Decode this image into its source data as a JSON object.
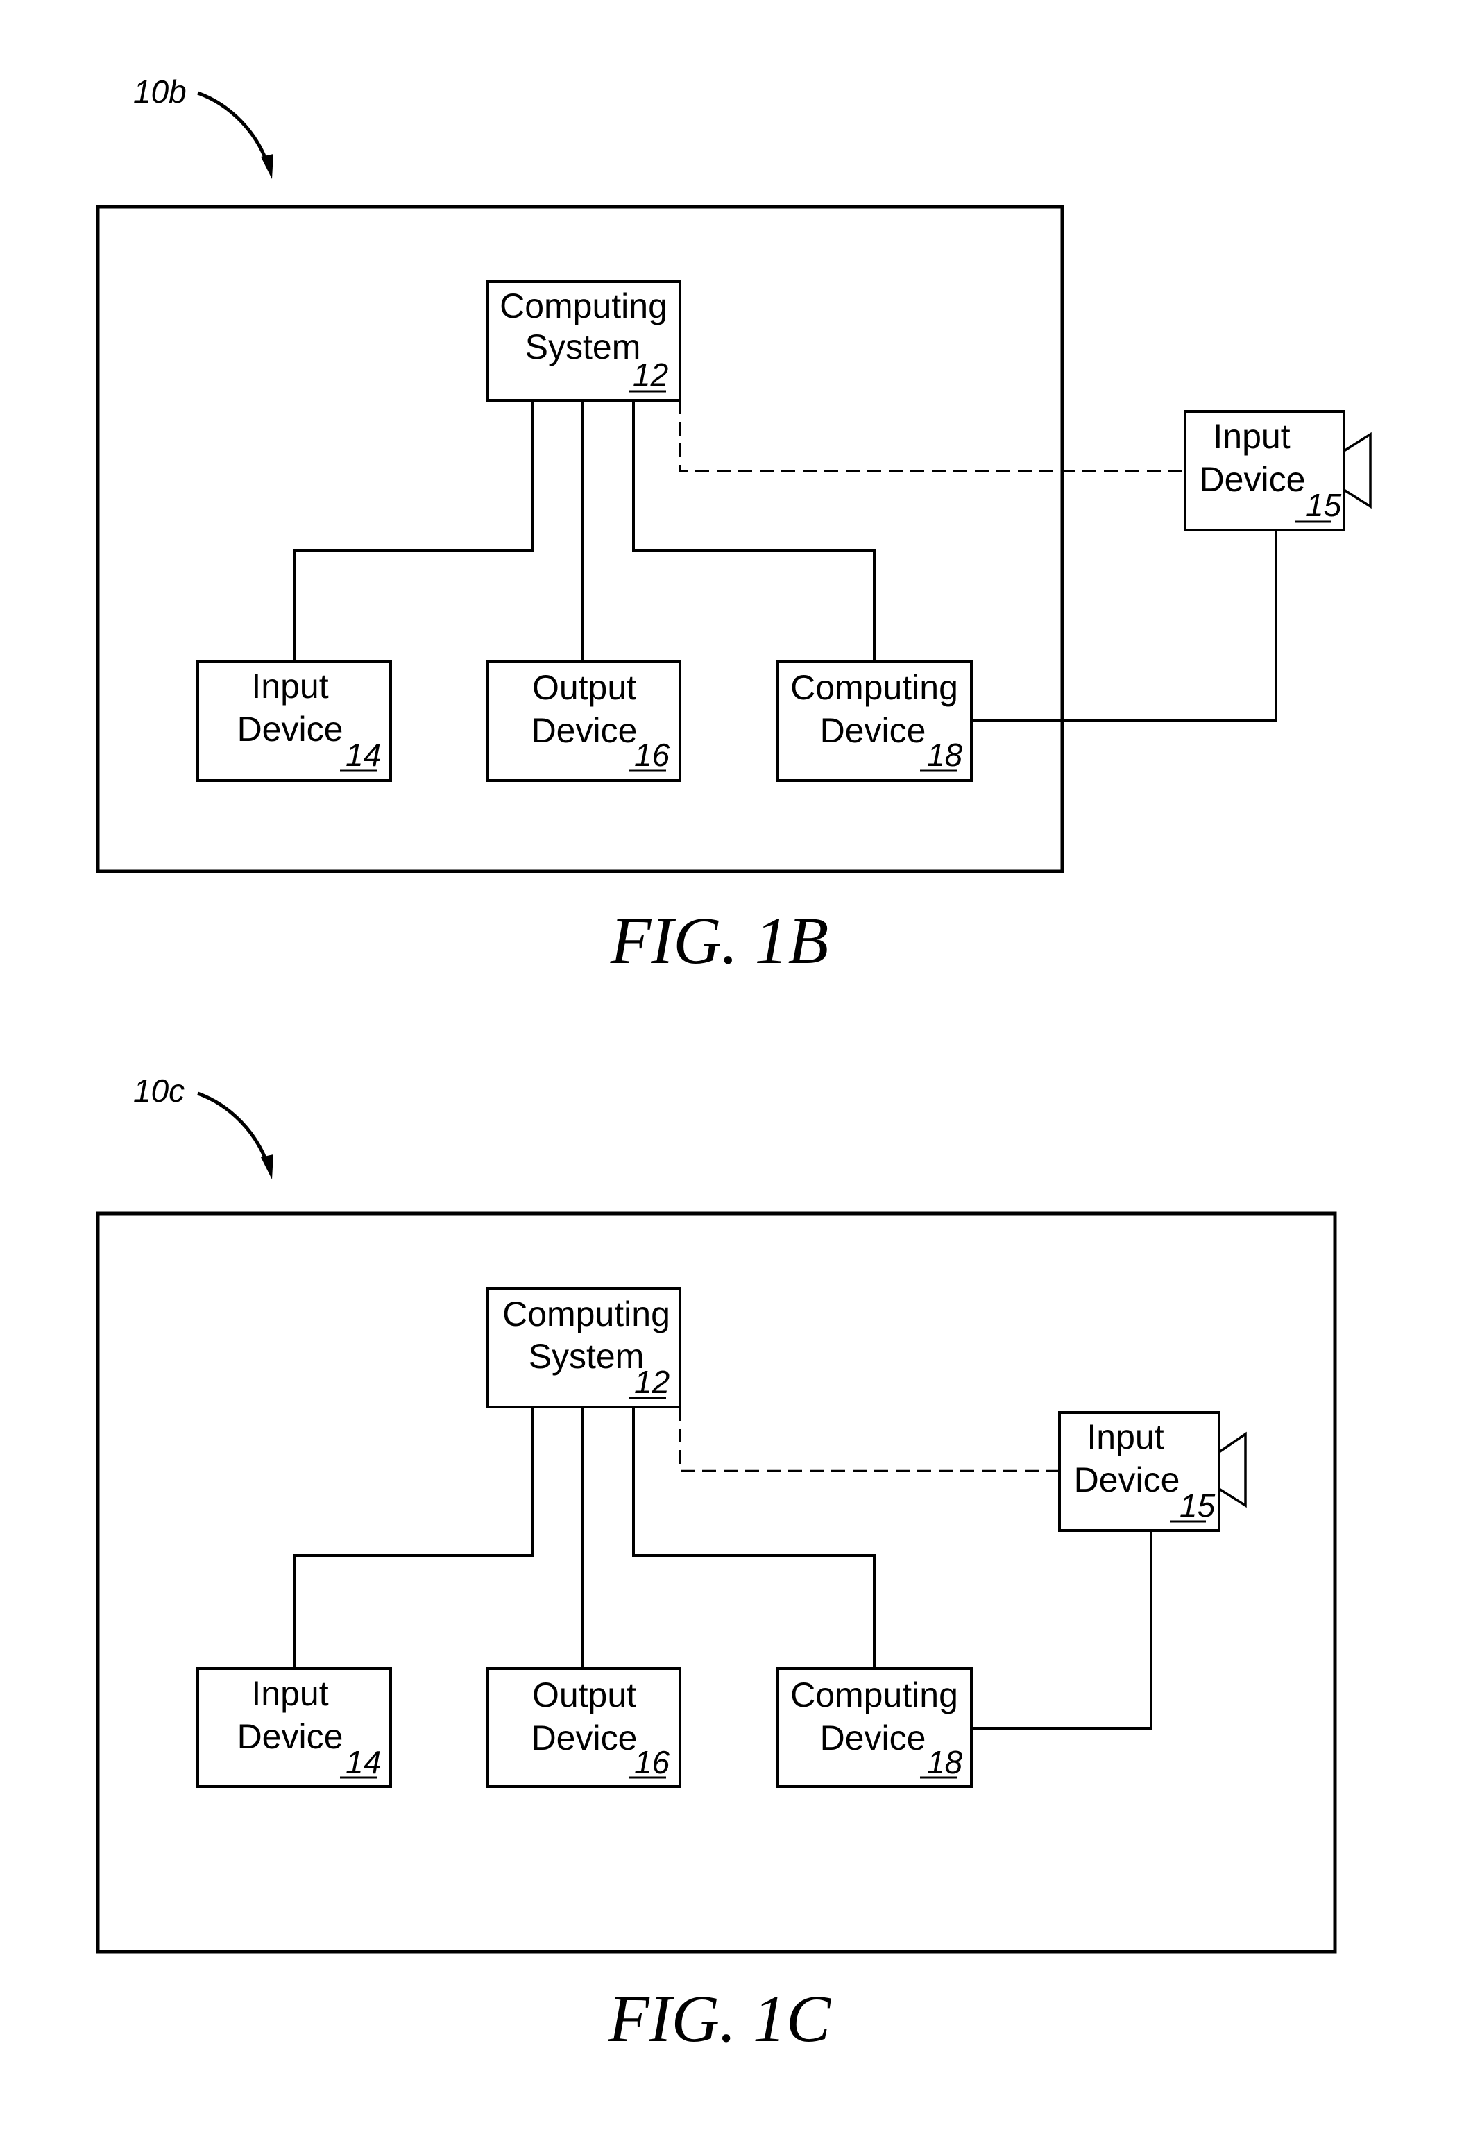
{
  "figures": [
    {
      "id": "fig-1b",
      "caption": "FIG. 1B",
      "reference_label": "10b",
      "boxes": {
        "computing_system": {
          "line1": "Computing",
          "line2": "System",
          "ref": "12"
        },
        "input_device_14": {
          "line1": "Input",
          "line2": "Device",
          "ref": "14"
        },
        "output_device": {
          "line1": "Output",
          "line2": "Device",
          "ref": "16"
        },
        "computing_device": {
          "line1": "Computing",
          "line2": "Device",
          "ref": "18"
        },
        "input_device_15": {
          "line1": "Input",
          "line2": "Device",
          "ref": "15",
          "placement": "outside frame"
        }
      },
      "connections": [
        {
          "from": "12",
          "to": "14",
          "style": "solid"
        },
        {
          "from": "12",
          "to": "16",
          "style": "solid"
        },
        {
          "from": "12",
          "to": "18",
          "style": "solid"
        },
        {
          "from": "12",
          "to": "15",
          "style": "dashed"
        },
        {
          "from": "18",
          "to": "15",
          "style": "solid"
        }
      ]
    },
    {
      "id": "fig-1c",
      "caption": "FIG. 1C",
      "reference_label": "10c",
      "boxes": {
        "computing_system": {
          "line1": "Computing",
          "line2": "System",
          "ref": "12"
        },
        "input_device_14": {
          "line1": "Input",
          "line2": "Device",
          "ref": "14"
        },
        "output_device": {
          "line1": "Output",
          "line2": "Device",
          "ref": "16"
        },
        "computing_device": {
          "line1": "Computing",
          "line2": "Device",
          "ref": "18"
        },
        "input_device_15": {
          "line1": "Input",
          "line2": "Device",
          "ref": "15",
          "placement": "inside frame"
        }
      },
      "connections": [
        {
          "from": "12",
          "to": "14",
          "style": "solid"
        },
        {
          "from": "12",
          "to": "16",
          "style": "solid"
        },
        {
          "from": "12",
          "to": "18",
          "style": "solid"
        },
        {
          "from": "12",
          "to": "15",
          "style": "dashed"
        },
        {
          "from": "18",
          "to": "15",
          "style": "solid"
        }
      ]
    }
  ],
  "icons": {
    "camera": "camera-icon"
  }
}
